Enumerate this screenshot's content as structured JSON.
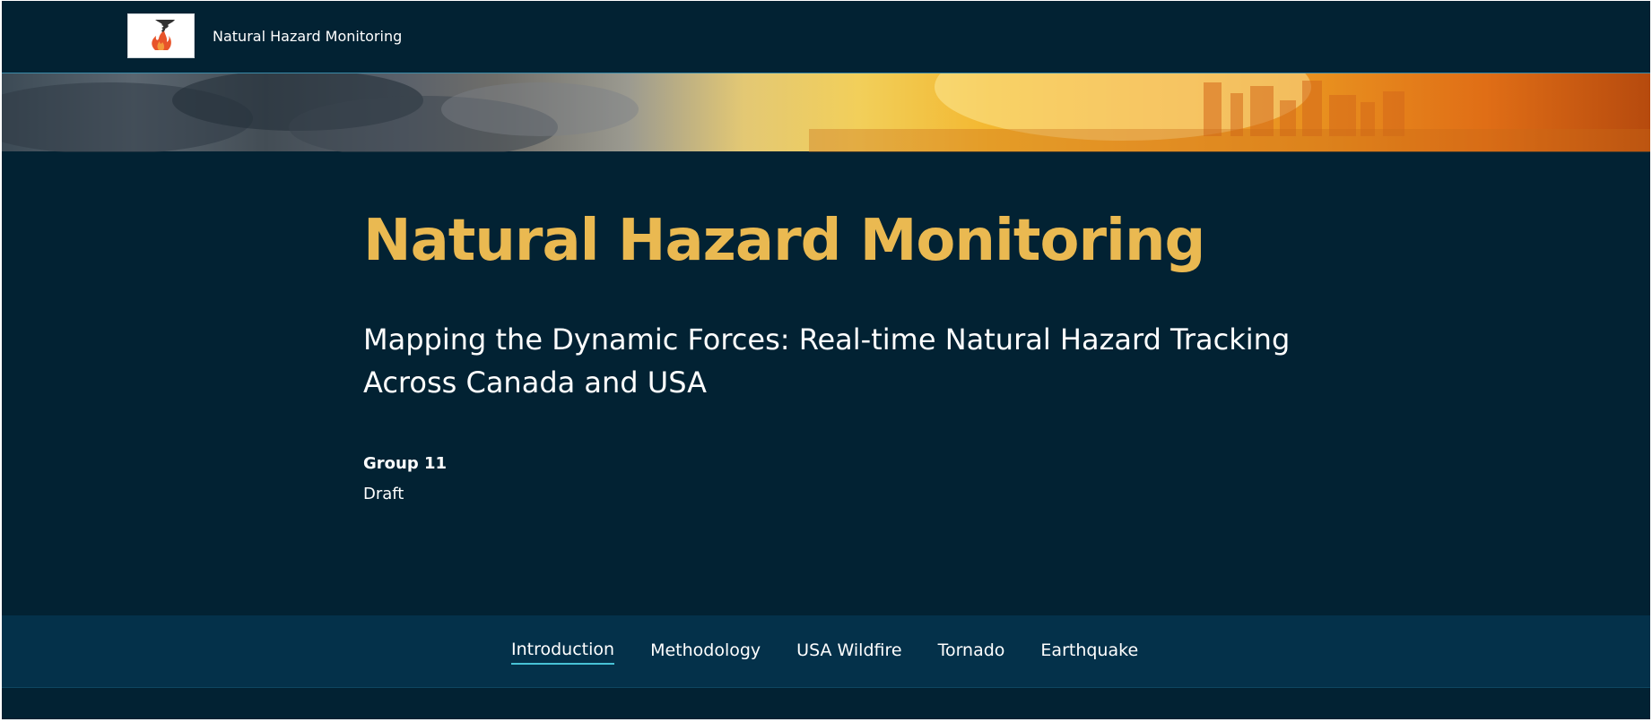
{
  "header": {
    "site_title": "Natural Hazard Monitoring",
    "logo_icon": "tornado-fire-logo-icon"
  },
  "hero": {
    "title": "Natural Hazard Monitoring",
    "subtitle": "Mapping the Dynamic Forces: Real-time Natural Hazard Tracking Across Canada and USA",
    "author": "Group 11",
    "status": "Draft"
  },
  "nav": {
    "items": [
      {
        "label": "Introduction",
        "active": true
      },
      {
        "label": "Methodology",
        "active": false
      },
      {
        "label": "USA Wildfire",
        "active": false
      },
      {
        "label": "Tornado",
        "active": false
      },
      {
        "label": "Earthquake",
        "active": false
      }
    ]
  },
  "colors": {
    "background": "#022233",
    "title_accent": "#eab951",
    "nav_background": "#04314a",
    "active_underline": "#47c2d6"
  }
}
